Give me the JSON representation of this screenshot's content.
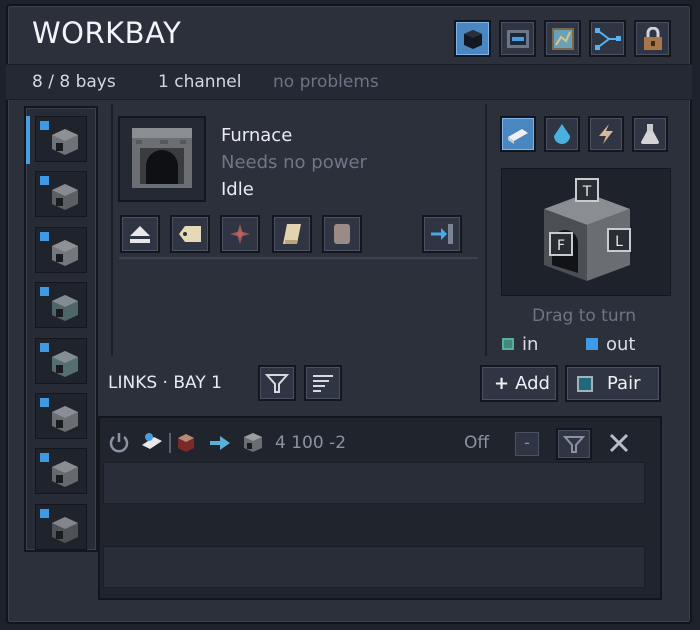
{
  "window": {
    "title": "WORKBAY"
  },
  "toolbar": {
    "icons": [
      "block-icon",
      "panel-icon",
      "map-icon",
      "network-icon",
      "lock-icon"
    ],
    "active_index": 0
  },
  "status": {
    "bays": "8 / 8 bays",
    "channels": "1 channel",
    "problems": "no problems"
  },
  "bays": {
    "count": 8,
    "selected_index": 0,
    "marker_color": "#3f9ae5"
  },
  "machine": {
    "name": "Furnace",
    "power": "Needs no power",
    "state": "Idle"
  },
  "tools": [
    "eject-icon",
    "label-icon",
    "compass-icon",
    "scroll-icon",
    "slot-icon",
    "exit-icon"
  ],
  "side_tabs": {
    "icons": [
      "item-icon",
      "fluid-icon",
      "energy-icon",
      "gas-icon"
    ],
    "active_index": 0
  },
  "preview": {
    "faces": {
      "top": "T",
      "front": "F",
      "left": "L"
    },
    "hint": "Drag to turn"
  },
  "legend": {
    "in": "in",
    "out": "out",
    "in_color": "#3f8a7a",
    "out_color": "#3f9ae5"
  },
  "links": {
    "title": "LINKS · BAY 1",
    "add_label": "Add",
    "pair_label": "Pair"
  },
  "link_rows": [
    {
      "coords": "4 100 -2",
      "state": "Off",
      "minus": "-"
    }
  ]
}
